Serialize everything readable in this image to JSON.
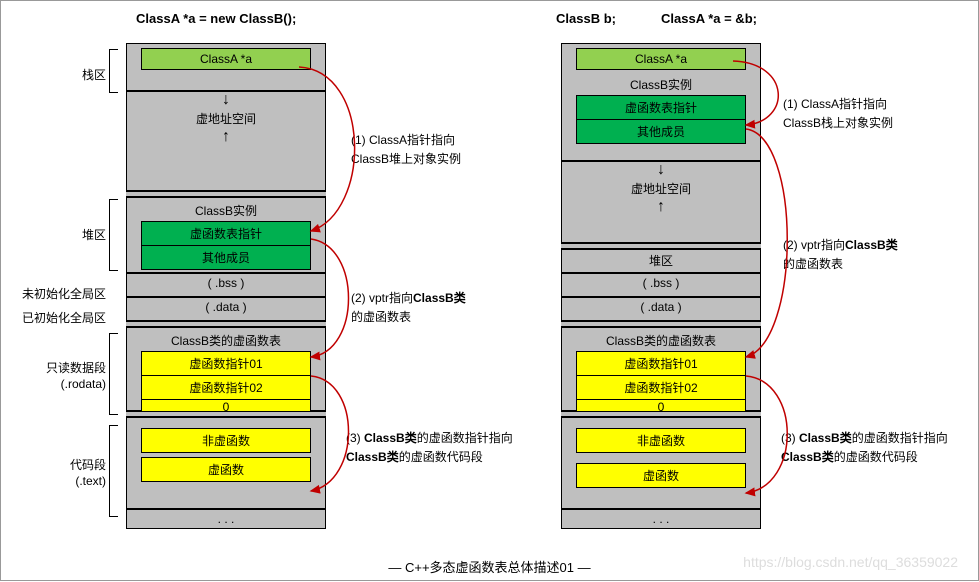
{
  "titles": {
    "left": "ClassA *a = new ClassB();",
    "right1": "ClassB b;",
    "right2": "ClassA *a = &b;"
  },
  "regions": {
    "stack": "栈区",
    "heap": "堆区",
    "bss": "未初始化全局区",
    "data": "已初始化全局区",
    "rodata1": "只读数据段",
    "rodata2": "(.rodata)",
    "text1": "代码段",
    "text2": "(.text)"
  },
  "cells": {
    "ptr": "ClassA *a",
    "vspace": "虚地址空间",
    "instance": "ClassB实例",
    "vptr": "虚函数表指针",
    "members": "其他成员",
    "heap": "堆区",
    "bssSeg": "( .bss )",
    "dataSeg": "( .data )",
    "vtable": "ClassB类的虚函数表",
    "vfp1": "虚函数指针01",
    "vfp2": "虚函数指针02",
    "zero": "0",
    "nonvf": "非虚函数",
    "vf": "虚函数",
    "dots": ". . ."
  },
  "notes": {
    "l1a": "(1) ClassA指针指向",
    "l1b_heap": "ClassB堆上对象实例",
    "l1b_stack": "ClassB栈上对象实例",
    "l2a": "(2) vptr指向",
    "l2b": "ClassB类",
    "l2c": "的虚函数表",
    "l3a": "(3) ",
    "l3b": "ClassB类",
    "l3c": "的虚函数指针指向",
    "l3d": "ClassB类",
    "l3e": "的虚函数代码段"
  },
  "caption": "—  C++多态虚函数表总体描述01  —",
  "watermark": "https://blog.csdn.net/qq_36359022"
}
